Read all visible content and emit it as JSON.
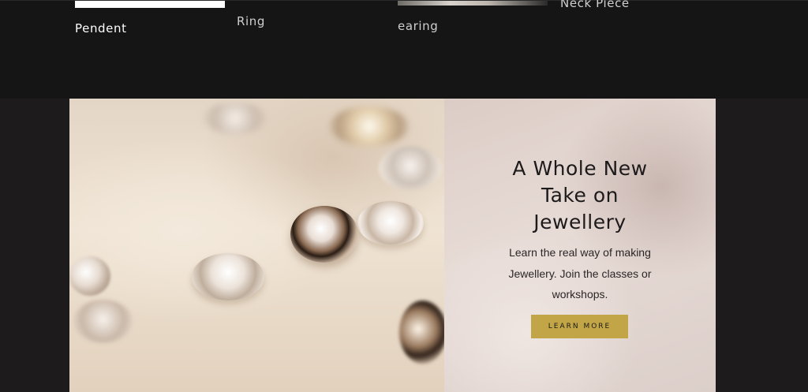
{
  "categories": [
    {
      "label": "Pendent"
    },
    {
      "label": "Ring"
    },
    {
      "label": "earing"
    },
    {
      "label": "Neck Piece"
    }
  ],
  "hero": {
    "title_lines": [
      "A Whole New",
      "Take on",
      "Jewellery"
    ],
    "description": "Learn the real way of making Jewellery. Join the classes or workshops.",
    "button_label": "LEARN MORE"
  },
  "colors": {
    "page_background": "#1d1b1c",
    "top_band": "#161516",
    "button": "#c1a547",
    "panel": "#e2d5d0"
  }
}
